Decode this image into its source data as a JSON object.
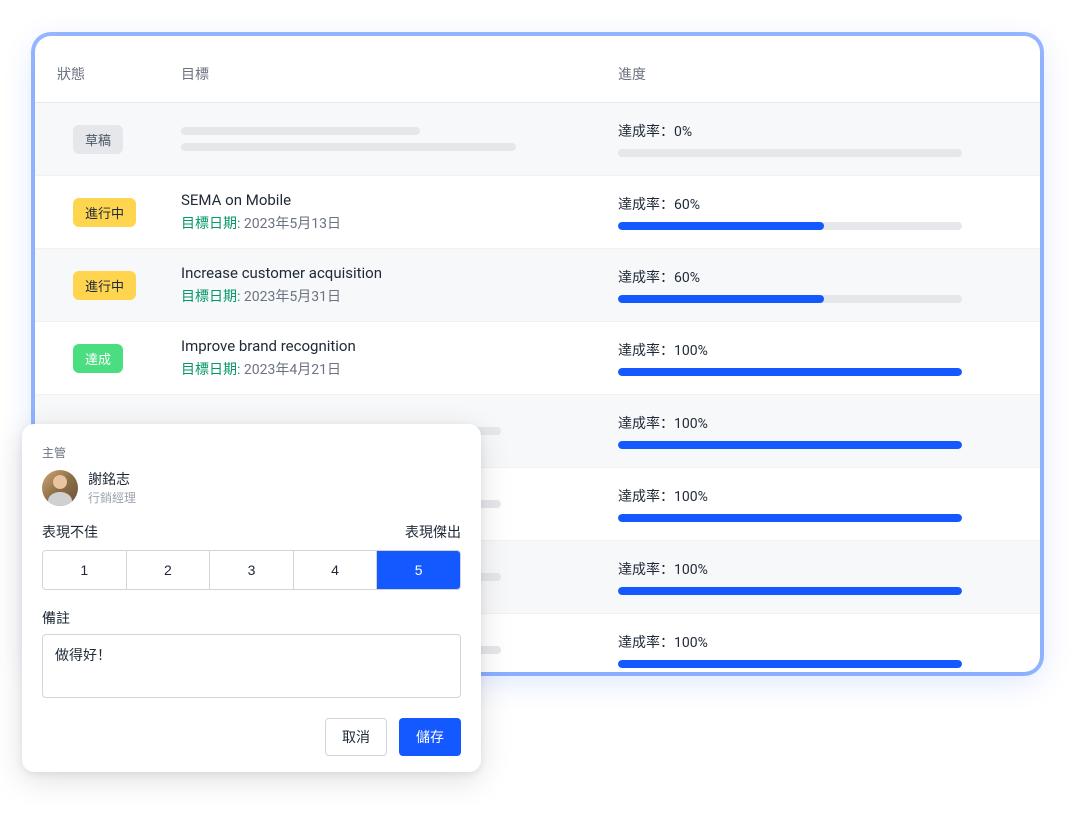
{
  "table": {
    "headers": {
      "status": "狀態",
      "goal": "目標",
      "progress": "進度"
    },
    "progress_prefix": "達成率：",
    "date_prefix": "目標日期: ",
    "status_labels": {
      "draft": "草稿",
      "in_progress": "進行中",
      "done": "達成"
    },
    "rows": [
      {
        "status": "draft",
        "title": "",
        "date": "",
        "progress_pct": 0,
        "progress_text": "0%",
        "skeleton": true
      },
      {
        "status": "in_progress",
        "title": "SEMA on Mobile",
        "date": "2023年5月13日",
        "progress_pct": 60,
        "progress_text": "60%"
      },
      {
        "status": "in_progress",
        "title": "Increase customer acquisition",
        "date": "2023年5月31日",
        "progress_pct": 60,
        "progress_text": "60%"
      },
      {
        "status": "done",
        "title": "Improve brand recognition",
        "date": "2023年4月21日",
        "progress_pct": 100,
        "progress_text": "100%"
      },
      {
        "status": "",
        "title": "",
        "date": "",
        "progress_pct": 100,
        "progress_text": "100%",
        "obscured": true
      },
      {
        "status": "",
        "title": "",
        "date": "",
        "progress_pct": 100,
        "progress_text": "100%",
        "obscured": true
      },
      {
        "status": "",
        "title": "",
        "date": "",
        "progress_pct": 100,
        "progress_text": "100%",
        "obscured": true
      },
      {
        "status": "",
        "title": "",
        "date": "",
        "progress_pct": 100,
        "progress_text": "100%",
        "obscured": true
      }
    ]
  },
  "overlay": {
    "supervisor_label": "主管",
    "user": {
      "name": "謝銘志",
      "role": "行銷經理"
    },
    "rating": {
      "low_label": "表現不佳",
      "high_label": "表現傑出",
      "options": [
        "1",
        "2",
        "3",
        "4",
        "5"
      ],
      "selected": "5"
    },
    "notes": {
      "label": "備註",
      "value": "做得好！"
    },
    "actions": {
      "cancel": "取消",
      "save": "儲存"
    }
  }
}
